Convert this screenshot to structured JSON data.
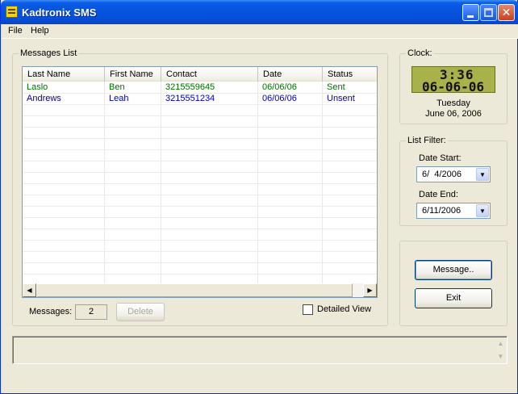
{
  "window": {
    "title": "Kadtronix SMS"
  },
  "menu": {
    "file": "File",
    "help": "Help"
  },
  "messages_group": {
    "legend": "Messages List",
    "columns": [
      "Last Name",
      "First Name",
      "Contact",
      "Date",
      "Status"
    ],
    "rows": [
      {
        "last": "Laslo",
        "first": "Ben",
        "contact": "3215559645",
        "date": "06/06/06",
        "status": "Sent",
        "color": "#007000"
      },
      {
        "last": "Andrews",
        "first": "Leah",
        "contact": "3215551234",
        "date": "06/06/06",
        "status": "Unsent",
        "color": "#0000b0"
      }
    ],
    "messages_label": "Messages:",
    "messages_count": "2",
    "delete_label": "Delete",
    "detailed_view_label": "Detailed View"
  },
  "clock": {
    "legend": "Clock:",
    "lcd_time": "3:36",
    "lcd_date": "06-06-06",
    "weekday": "Tuesday",
    "date_long": "June 06, 2006"
  },
  "filter": {
    "legend": "List Filter:",
    "start_label": "Date Start:",
    "start_value": "6/  4/2006",
    "end_label": "Date End:",
    "end_value": "6/11/2006"
  },
  "actions": {
    "message_label": "Message..",
    "exit_label": "Exit"
  },
  "icons": {
    "app": "app-icon",
    "minimize": "minimize-icon",
    "maximize": "maximize-icon",
    "close": "close-icon",
    "scroll_left": "arrow-left-icon",
    "scroll_right": "arrow-right-icon",
    "dropdown": "chevron-down-icon"
  }
}
